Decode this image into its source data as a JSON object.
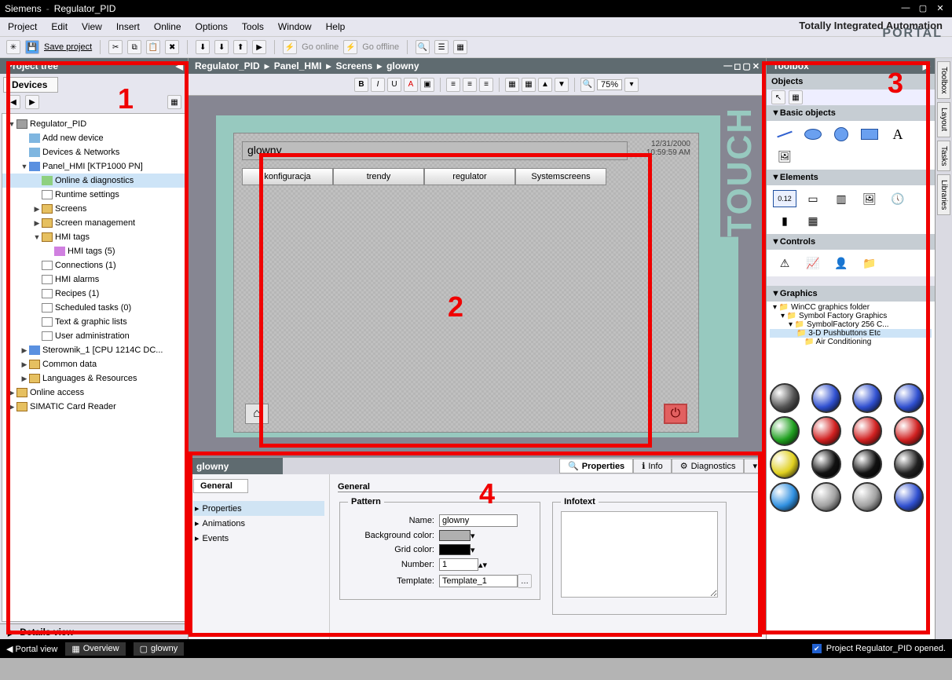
{
  "title": {
    "app": "Siemens",
    "project": "Regulator_PID"
  },
  "menu": [
    "Project",
    "Edit",
    "View",
    "Insert",
    "Online",
    "Options",
    "Tools",
    "Window",
    "Help"
  ],
  "branding": {
    "line": "Totally Integrated Automation",
    "portal": "PORTAL"
  },
  "toolbar": {
    "save": "Save project",
    "goonline": "Go online",
    "gooffline": "Go offline"
  },
  "projecttree": {
    "title": "Project tree",
    "devices": "Devices",
    "nodes": [
      {
        "lvl": 0,
        "caret": "▼",
        "ico": "ico-chip",
        "label": "Regulator_PID"
      },
      {
        "lvl": 1,
        "caret": "",
        "ico": "ico-dev",
        "label": "Add new device"
      },
      {
        "lvl": 1,
        "caret": "",
        "ico": "ico-dev",
        "label": "Devices & Networks"
      },
      {
        "lvl": 1,
        "caret": "▼",
        "ico": "ico-blue",
        "label": "Panel_HMI [KTP1000 PN]"
      },
      {
        "lvl": 2,
        "caret": "",
        "ico": "ico-green",
        "label": "Online & diagnostics",
        "sel": true
      },
      {
        "lvl": 2,
        "caret": "",
        "ico": "ico-doc",
        "label": "Runtime settings"
      },
      {
        "lvl": 2,
        "caret": "▶",
        "ico": "ico-folder",
        "label": "Screens"
      },
      {
        "lvl": 2,
        "caret": "▶",
        "ico": "ico-folder",
        "label": "Screen management"
      },
      {
        "lvl": 2,
        "caret": "▼",
        "ico": "ico-folder",
        "label": "HMI tags"
      },
      {
        "lvl": 3,
        "caret": "",
        "ico": "ico-tag",
        "label": "HMI tags (5)"
      },
      {
        "lvl": 2,
        "caret": "",
        "ico": "ico-doc",
        "label": "Connections (1)"
      },
      {
        "lvl": 2,
        "caret": "",
        "ico": "ico-doc",
        "label": "HMI alarms"
      },
      {
        "lvl": 2,
        "caret": "",
        "ico": "ico-doc",
        "label": "Recipes (1)"
      },
      {
        "lvl": 2,
        "caret": "",
        "ico": "ico-doc",
        "label": "Scheduled tasks (0)"
      },
      {
        "lvl": 2,
        "caret": "",
        "ico": "ico-doc",
        "label": "Text & graphic lists"
      },
      {
        "lvl": 2,
        "caret": "",
        "ico": "ico-doc",
        "label": "User administration"
      },
      {
        "lvl": 1,
        "caret": "▶",
        "ico": "ico-blue",
        "label": "Sterownik_1 [CPU 1214C DC..."
      },
      {
        "lvl": 1,
        "caret": "▶",
        "ico": "ico-folder",
        "label": "Common data"
      },
      {
        "lvl": 1,
        "caret": "▶",
        "ico": "ico-folder",
        "label": "Languages & Resources"
      },
      {
        "lvl": 0,
        "caret": "▶",
        "ico": "ico-folder",
        "label": "Online access"
      },
      {
        "lvl": 0,
        "caret": "▶",
        "ico": "ico-folder",
        "label": "SIMATIC Card Reader"
      }
    ],
    "details": "Details view"
  },
  "breadcrumb": [
    "Regulator_PID",
    "Panel_HMI",
    "Screens",
    "glowny"
  ],
  "zoom": "75%",
  "hmi": {
    "title": "glowny",
    "date": "12/31/2000",
    "time": "10:59:59 AM",
    "buttons": [
      "konfiguracja",
      "trendy",
      "regulator",
      "Systemscreens"
    ],
    "touch": "TOUCH"
  },
  "props": {
    "name": "glowny",
    "tabs": {
      "general": "General",
      "properties": "Properties",
      "info": "Info",
      "diagnostics": "Diagnostics"
    },
    "left": [
      "Properties",
      "Animations",
      "Events"
    ],
    "section": "General",
    "pattern": {
      "group": "Pattern",
      "l_name": "Name:",
      "v_name": "glowny",
      "l_bg": "Background color:",
      "v_bg": "#b0b0b0",
      "l_grid": "Grid color:",
      "v_grid": "#000000",
      "l_num": "Number:",
      "v_num": "1",
      "l_tpl": "Template:",
      "v_tpl": "Template_1"
    },
    "infotext": "Infotext"
  },
  "toolbox": {
    "title": "Toolbox",
    "objects": "Objects",
    "basic": "Basic objects",
    "elements": "Elements",
    "controls": "Controls",
    "graphics": "Graphics",
    "gtree": [
      "WinCC graphics folder",
      "Symbol Factory Graphics",
      "SymbolFactory 256 C...",
      "3-D Pushbuttons Etc",
      "Air Conditioning"
    ],
    "ballcolors": [
      "#555",
      "#3050d0",
      "#3050d0",
      "#3050d0",
      "#20a020",
      "#d02020",
      "#d02020",
      "#d02020",
      "#e0d020",
      "#111",
      "#111",
      "#202020",
      "#3090e0",
      "#a0a0a0",
      "#a0a0a0",
      "#3050d0"
    ]
  },
  "sidetabs": [
    "Toolbox",
    "Layout",
    "Tasks",
    "Libraries"
  ],
  "status": {
    "portal": "Portal view",
    "overview": "Overview",
    "screen": "glowny",
    "msg": "Project Regulator_PID opened."
  },
  "annot": {
    "n1": "1",
    "n2": "2",
    "n3": "3",
    "n4": "4"
  }
}
